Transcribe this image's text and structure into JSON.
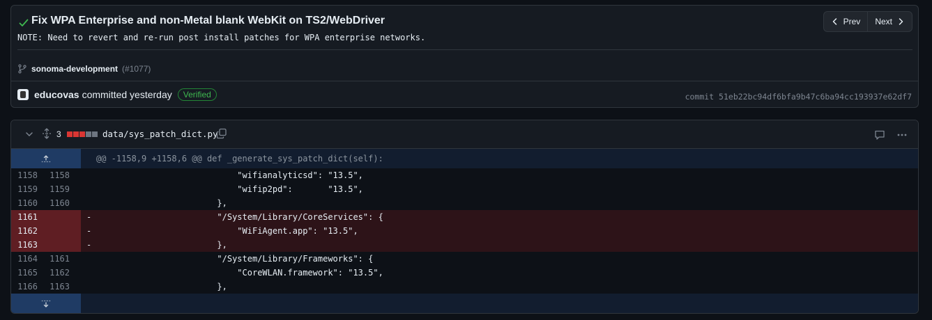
{
  "commit": {
    "title": "Fix WPA Enterprise and non-Metal blank WebKit on TS2/WebDriver",
    "note": "NOTE: Need to revert and re-run post install patches for WPA enterprise networks.",
    "prev_label": "Prev",
    "next_label": "Next",
    "branch": "sonoma-development",
    "pr_ref": "(#1077)",
    "author": "educovas",
    "committed_text": "committed yesterday",
    "verified_label": "Verified",
    "sha_text": "commit 51eb22bc94df6bfa9b47c6ba94cc193937e62df7",
    "status_color": "#3fb950"
  },
  "file": {
    "change_count": "3",
    "path": "data/sys_patch_dict.py",
    "diffstat_colors": [
      "#da3633",
      "#da3633",
      "#da3633",
      "#6e7681",
      "#6e7681"
    ],
    "hunk_header": "@@ -1158,9 +1158,6 @@ def _generate_sys_patch_dict(self):",
    "lines": [
      {
        "old": "1158",
        "new": "1158",
        "marker": "",
        "code": "                            \"wifianalyticsd\": \"13.5\",",
        "type": "context"
      },
      {
        "old": "1159",
        "new": "1159",
        "marker": "",
        "code": "                            \"wifip2pd\":       \"13.5\",",
        "type": "context"
      },
      {
        "old": "1160",
        "new": "1160",
        "marker": "",
        "code": "                        },",
        "type": "context"
      },
      {
        "old": "1161",
        "new": "",
        "marker": "-",
        "code": "                        \"/System/Library/CoreServices\": {",
        "type": "del"
      },
      {
        "old": "1162",
        "new": "",
        "marker": "-",
        "code": "                            \"WiFiAgent.app\": \"13.5\",",
        "type": "del"
      },
      {
        "old": "1163",
        "new": "",
        "marker": "-",
        "code": "                        },",
        "type": "del"
      },
      {
        "old": "1164",
        "new": "1161",
        "marker": "",
        "code": "                        \"/System/Library/Frameworks\": {",
        "type": "context"
      },
      {
        "old": "1165",
        "new": "1162",
        "marker": "",
        "code": "                            \"CoreWLAN.framework\": \"13.5\",",
        "type": "context"
      },
      {
        "old": "1166",
        "new": "1163",
        "marker": "",
        "code": "                        },",
        "type": "context"
      }
    ]
  },
  "icons": {
    "check": "check-icon",
    "prev": "chevron-left-icon",
    "next": "chevron-right-icon",
    "branch": "git-branch-icon",
    "collapse": "chevron-down-icon",
    "expand": "unfold-icon",
    "copy": "copy-icon",
    "comment": "comment-icon",
    "more": "kebab-horizontal-icon",
    "expand_up": "fold-up-icon",
    "expand_down": "fold-down-icon"
  }
}
